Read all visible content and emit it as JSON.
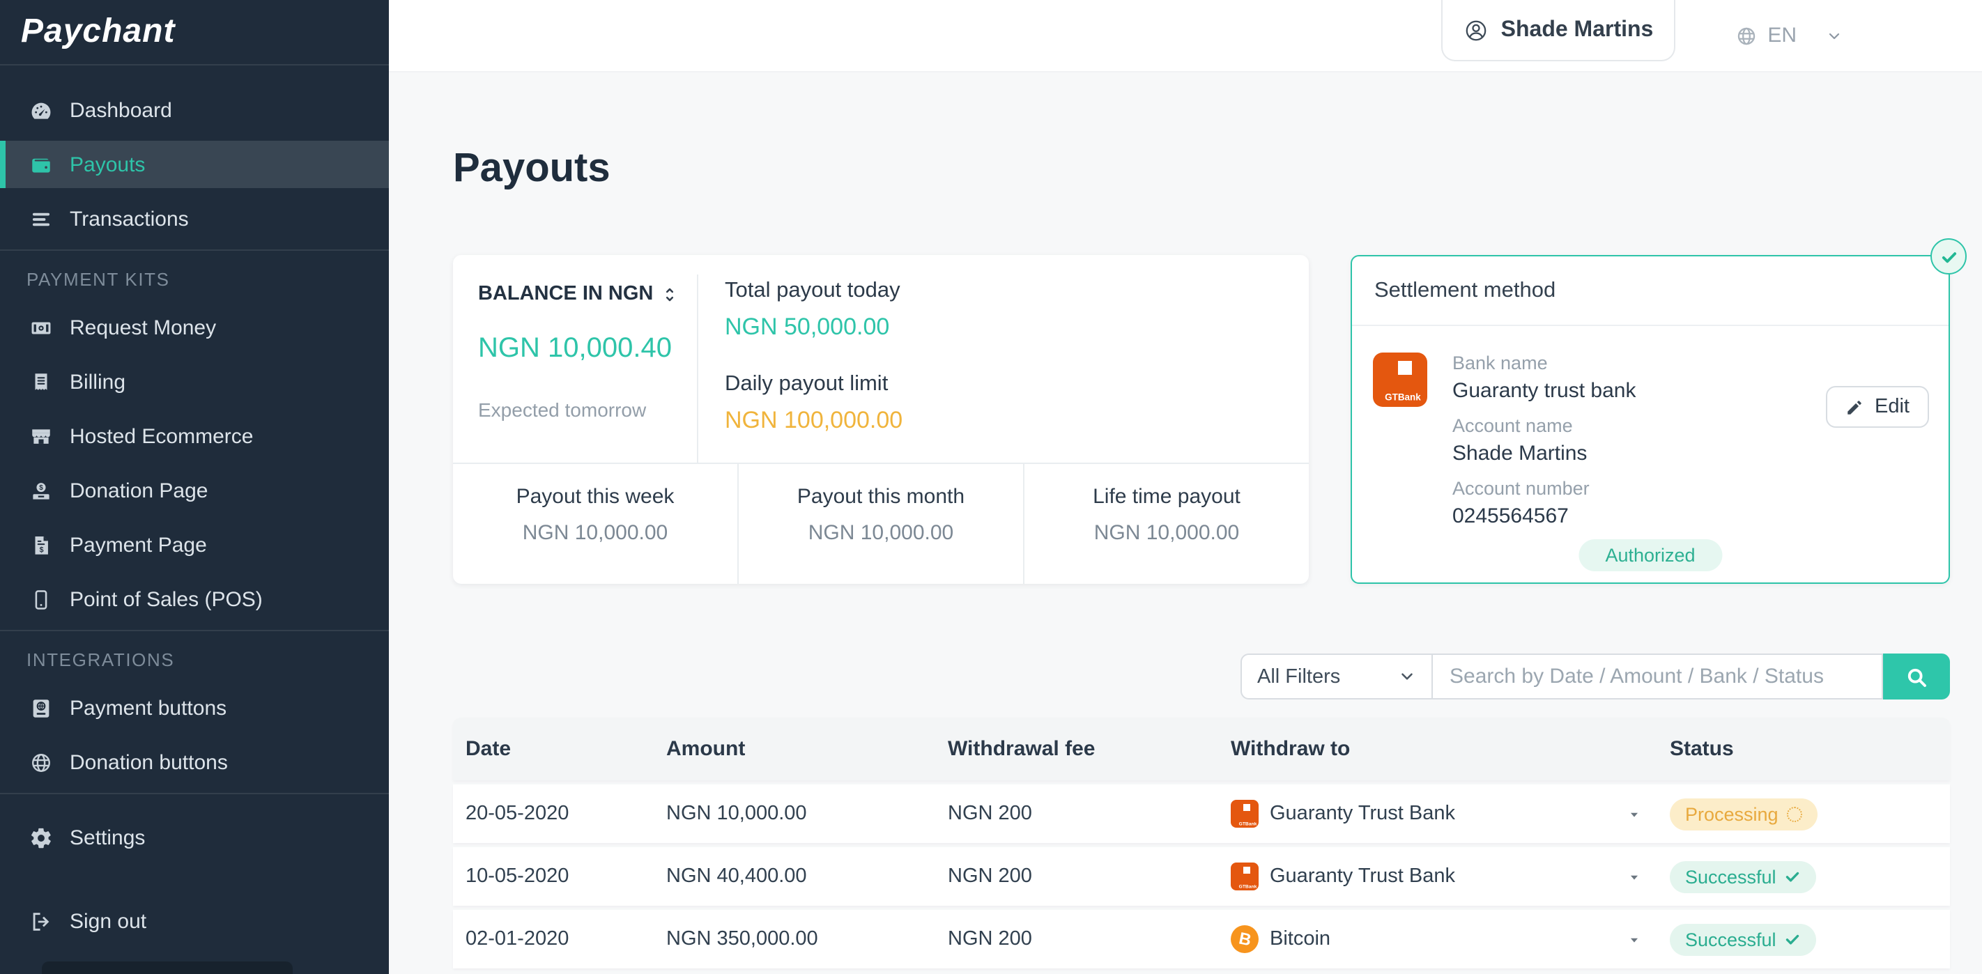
{
  "brand": {
    "logo": "Paychant"
  },
  "sidebar": {
    "main_items": [
      {
        "label": "Dashboard",
        "icon": "gauge-icon",
        "active": false
      },
      {
        "label": "Payouts",
        "icon": "wallet-icon",
        "active": true
      },
      {
        "label": "Transactions",
        "icon": "list-icon",
        "active": false
      }
    ],
    "sections": [
      {
        "label": "PAYMENT KITS",
        "items": [
          {
            "label": "Request Money",
            "icon": "money-bill-icon"
          },
          {
            "label": "Billing",
            "icon": "receipt-icon"
          },
          {
            "label": "Hosted Ecommerce",
            "icon": "store-icon"
          },
          {
            "label": "Donation Page",
            "icon": "donate-icon"
          },
          {
            "label": "Payment Page",
            "icon": "invoice-icon"
          },
          {
            "label": "Point of Sales (POS)",
            "icon": "mobile-icon"
          }
        ]
      },
      {
        "label": "INTEGRATIONS",
        "items": [
          {
            "label": "Payment buttons",
            "icon": "payment-window-icon"
          },
          {
            "label": "Donation buttons",
            "icon": "globe-icon"
          }
        ]
      }
    ],
    "footer_items": [
      {
        "label": "Settings",
        "icon": "gear-icon"
      },
      {
        "label": "Sign out",
        "icon": "sign-out-icon"
      }
    ]
  },
  "header": {
    "user_name": "Shade Martins",
    "language": "EN"
  },
  "page": {
    "title": "Payouts"
  },
  "balance_card": {
    "balance_label": "BALANCE IN NGN",
    "balance_value": "NGN 10,000.40",
    "balance_note": "Expected tomorrow",
    "total_payout_today_label": "Total payout today",
    "total_payout_today_value": "NGN 50,000.00",
    "daily_limit_label": "Daily payout limit",
    "daily_limit_value": "NGN 100,000.00",
    "stats": [
      {
        "label": "Payout this week",
        "value": "NGN 10,000.00"
      },
      {
        "label": "Payout this month",
        "value": "NGN 10,000.00"
      },
      {
        "label": "Life time payout",
        "value": "NGN 10,000.00"
      }
    ]
  },
  "settlement_card": {
    "title": "Settlement method",
    "bank_logo_text": "GTBank",
    "bank_name_label": "Bank name",
    "bank_name": "Guaranty trust bank",
    "edit_label": "Edit",
    "account_name_label": "Account name",
    "account_name": "Shade Martins",
    "account_number_label": "Account number",
    "account_number": "0245564567",
    "status_badge": "Authorized"
  },
  "filters": {
    "filter_label": "All Filters",
    "search_placeholder": "Search by Date / Amount / Bank / Status"
  },
  "table": {
    "columns": [
      "Date",
      "Amount",
      "Withdrawal fee",
      "Withdraw to",
      "Status"
    ],
    "rows": [
      {
        "date": "20-05-2020",
        "amount": "NGN 10,000.00",
        "fee": "NGN 200",
        "bank": "Guaranty Trust Bank",
        "bank_icon": "gtbank-logo-icon",
        "status": "Processing",
        "status_state": "processing"
      },
      {
        "date": "10-05-2020",
        "amount": "NGN 40,400.00",
        "fee": "NGN 200",
        "bank": "Guaranty Trust Bank",
        "bank_icon": "gtbank-logo-icon",
        "status": "Successful",
        "status_state": "successful"
      },
      {
        "date": "02-01-2020",
        "amount": "NGN 350,000.00",
        "fee": "NGN 200",
        "bank": "Bitcoin",
        "bank_icon": "bitcoin-icon",
        "status": "Successful",
        "status_state": "successful"
      }
    ]
  },
  "colors": {
    "accent_teal": "#2ec4a9",
    "amber": "#f0b43c",
    "sidebar_bg": "#1f2c3b",
    "success_text": "#2aad90",
    "processing_text": "#e8a93e",
    "gtbank_orange": "#e4570f",
    "bitcoin_orange": "#f7941d"
  }
}
